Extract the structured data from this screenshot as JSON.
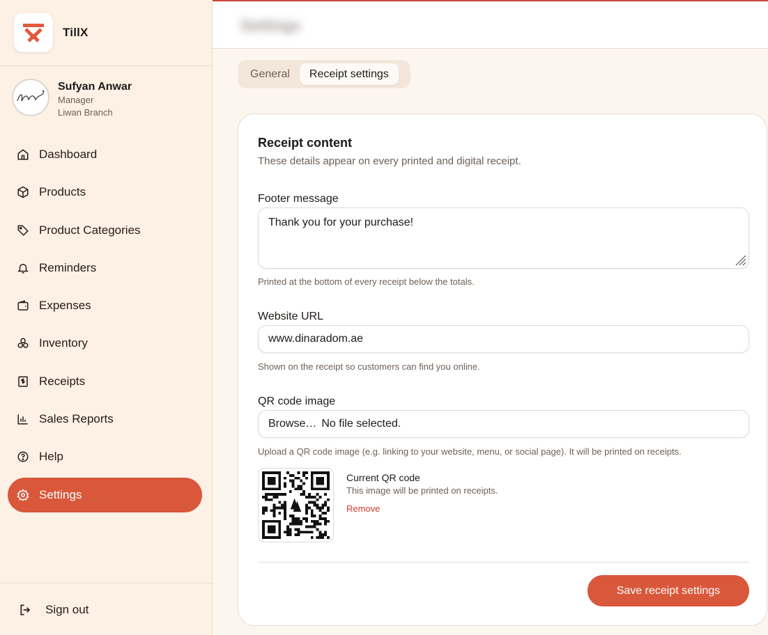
{
  "brand": {
    "name": "TillX",
    "accent": "#d9573a"
  },
  "user": {
    "name": "Sufyan Anwar",
    "role": "Manager",
    "branch": "Liwan Branch"
  },
  "nav": {
    "items": [
      {
        "label": "Dashboard",
        "icon": "home-icon"
      },
      {
        "label": "Products",
        "icon": "box-icon"
      },
      {
        "label": "Product Categories",
        "icon": "tag-icon"
      },
      {
        "label": "Reminders",
        "icon": "bell-icon"
      },
      {
        "label": "Expenses",
        "icon": "wallet-icon"
      },
      {
        "label": "Inventory",
        "icon": "boxes-icon"
      },
      {
        "label": "Receipts",
        "icon": "receipt-icon"
      },
      {
        "label": "Sales Reports",
        "icon": "bar-chart-icon"
      },
      {
        "label": "Help",
        "icon": "help-icon"
      },
      {
        "label": "Settings",
        "icon": "gear-icon",
        "active": true
      }
    ],
    "signout": "Sign out"
  },
  "header": {
    "title": "Settings"
  },
  "tabs": {
    "general": "General",
    "receipt": "Receipt settings"
  },
  "card": {
    "title": "Receipt content",
    "description": "These details appear on every printed and digital receipt.",
    "footer": {
      "label": "Footer message",
      "value": "Thank you for your purchase!",
      "hint": "Printed at the bottom of every receipt below the totals."
    },
    "website": {
      "label": "Website URL",
      "value": "www.dinaradom.ae",
      "hint": "Shown on the receipt so customers can find you online."
    },
    "qr": {
      "label": "QR code image",
      "browse": "Browse…",
      "file_status": "No file selected.",
      "hint": "Upload a QR code image (e.g. linking to your website, menu, or social page). It will be printed on receipts.",
      "current_title": "Current QR code",
      "current_desc": "This image will be printed on receipts.",
      "remove": "Remove"
    },
    "save": "Save receipt settings"
  }
}
